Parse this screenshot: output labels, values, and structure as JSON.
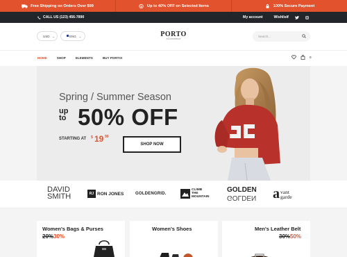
{
  "promo": {
    "shipping": "Free Shipping on Orders Over $99",
    "discount": "Up to 40% OFF on Selected Items",
    "secure": "100% Secure Payment"
  },
  "topbar": {
    "phone": "CALL US (123) 456-7890",
    "my_account": "My account",
    "wishlist": "Wishlist"
  },
  "header": {
    "currency": "USD",
    "language": "ENG",
    "logo": "PORTO",
    "logo_sub": "eCommerce",
    "search_placeholder": "Search..."
  },
  "nav": {
    "items": [
      "HOME",
      "SHOP",
      "ELEMENTS",
      "BUY PORTO!"
    ],
    "cart_count": "0"
  },
  "hero": {
    "season": "Spring / Summer Season",
    "up_to": "up to",
    "offer": "50% OFF",
    "starting_at": "STARTING AT",
    "currency": "$",
    "price": "19",
    "cents": "99",
    "button": "SHOP NOW"
  },
  "brands": {
    "david_smith_1": "DAVID",
    "david_smith_2": "SMITH",
    "ron_jones_mark": "RJ",
    "ron_jones": "RON JONES",
    "goldengrid": "GOLDENGRID.",
    "climb_1": "CLIMB",
    "climb_2": "THE",
    "climb_3": "MOUNTAIN",
    "golden_1": "GOLDEN",
    "golden_2": "GOLDEN",
    "avantgarde_a": "a",
    "avantgarde_1": "vant",
    "avantgarde_2": "garde"
  },
  "products": [
    {
      "title": "Women's Bags & Purses",
      "old": "20%",
      "new": "30%"
    },
    {
      "title": "Women's Shoes"
    },
    {
      "title": "Men's Leather Belt",
      "old": "30%",
      "new": "50%"
    }
  ],
  "colors": {
    "accent": "#e2532d",
    "dark": "#222529"
  }
}
